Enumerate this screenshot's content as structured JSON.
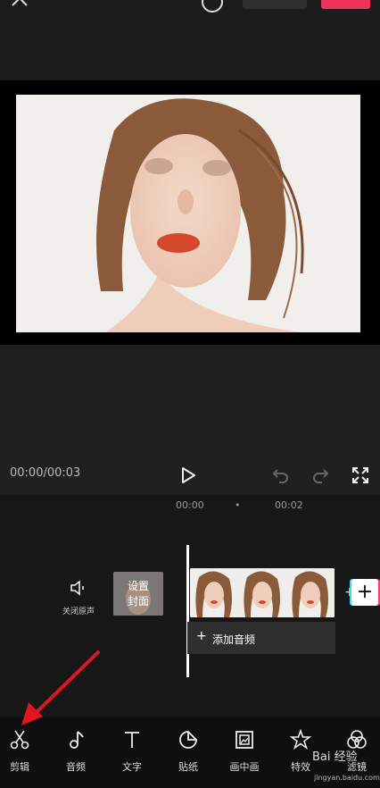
{
  "player": {
    "time": "00:00/00:03"
  },
  "ruler": {
    "tick1": "00:00",
    "dot": "•",
    "tick2": "00:02"
  },
  "track": {
    "mute_label": "关闭原声",
    "cover_label_line1": "设置",
    "cover_label_line2": "封面",
    "add_audio_label": "添加音频",
    "add_audio_plus": "+",
    "side_plus": "+",
    "add_clip_plus": "+"
  },
  "toolbar": {
    "items": [
      {
        "label": "剪辑",
        "icon": "scissors-icon"
      },
      {
        "label": "音频",
        "icon": "music-note-icon"
      },
      {
        "label": "文字",
        "icon": "text-icon"
      },
      {
        "label": "贴纸",
        "icon": "sticker-icon"
      },
      {
        "label": "画中画",
        "icon": "picture-in-picture-icon"
      },
      {
        "label": "特效",
        "icon": "effects-icon"
      },
      {
        "label": "滤镜",
        "icon": "filter-icon"
      }
    ]
  },
  "watermark": {
    "text": "Bai 经验",
    "url": "jingyan.baidu.com"
  },
  "colors": {
    "accent": "#f0335a",
    "annotation_arrow": "#e0161e"
  }
}
